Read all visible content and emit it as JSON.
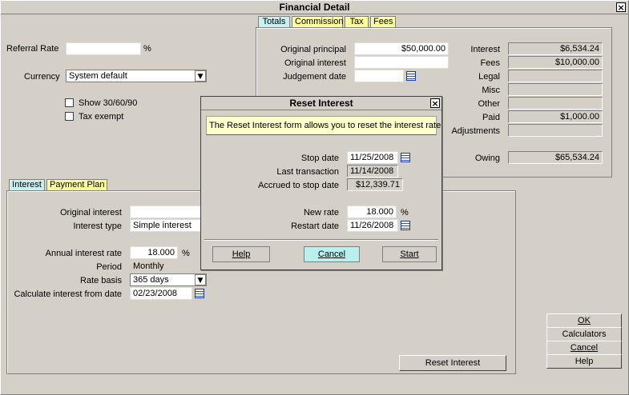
{
  "window": {
    "title": "Financial Detail",
    "close": "×"
  },
  "top_left": {
    "referral_rate_label": "Referral Rate",
    "referral_rate_value": "",
    "percent_sign": "%",
    "currency_label": "Currency",
    "currency_value": "System default",
    "show_30_60_90_label": "Show 30/60/90",
    "tax_exempt_label": "Tax exempt"
  },
  "top_tabs": [
    "Totals",
    "Commission",
    "Tax",
    "Fees"
  ],
  "totals": {
    "original_principal_label": "Original principal",
    "original_principal_value": "$50,000.00",
    "original_interest_label": "Original interest",
    "original_interest_value": "",
    "judgement_date_label": "Judgement date",
    "judgement_date_value": "",
    "interest_label": "Interest",
    "interest_value": "$6,534.24",
    "fees_label": "Fees",
    "fees_value": "$10,000.00",
    "legal_label": "Legal",
    "legal_value": "",
    "misc_label": "Misc",
    "misc_value": "",
    "other_label": "Other",
    "other_value": "",
    "paid_label": "Paid",
    "paid_value": "$1,000.00",
    "adjustments_label": "Adjustments",
    "adjustments_value": "",
    "owing_label": "Owing",
    "owing_value": "$65,534.24"
  },
  "bottom_tabs": [
    "Interest",
    "Payment Plan"
  ],
  "interest": {
    "original_interest_label": "Original interest",
    "original_interest_value": "",
    "interest_type_label": "Interest type",
    "interest_type_value": "Simple interest",
    "annual_rate_label": "Annual interest rate",
    "annual_rate_value": "18.000",
    "percent_sign": "%",
    "period_label": "Period",
    "period_value": "Monthly",
    "rate_basis_label": "Rate basis",
    "rate_basis_value": "365 days",
    "calc_from_label": "Calculate interest from date",
    "calc_from_value": "02/23/2008"
  },
  "buttons": {
    "reset_interest": "Reset Interest",
    "ok": "OK",
    "calculators": "Calculators",
    "cancel": "Cancel",
    "help": "Help"
  },
  "dialog": {
    "title": "Reset Interest",
    "close": "×",
    "info": "The Reset Interest form allows you to reset the interest rate",
    "stop_date_label": "Stop date",
    "stop_date_value": "11/25/2008",
    "last_transaction_label": "Last transaction",
    "last_transaction_value": "11/14/2008",
    "accrued_label": "Accrued to stop date",
    "accrued_value": "$12,339.71",
    "new_rate_label": "New rate",
    "new_rate_value": "18.000",
    "percent_sign": "%",
    "restart_date_label": "Restart date",
    "restart_date_value": "11/26/2008",
    "help_button": "Help",
    "cancel_button": "Cancel",
    "start_button": "Start"
  }
}
